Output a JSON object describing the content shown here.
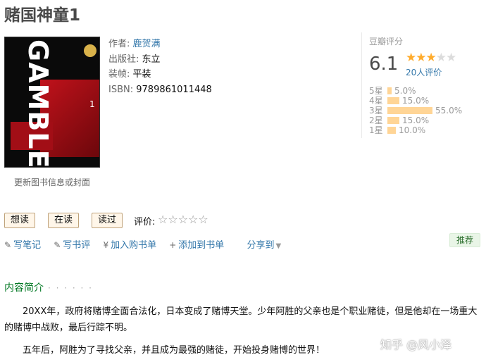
{
  "title": "赌国神童1",
  "cover": {
    "art_text": "GAMBLE!",
    "volume": "1",
    "update_link": "更新图书信息或封面"
  },
  "info": {
    "author_label": "作者:",
    "author": "鹿贺满",
    "publisher_label": "出版社:",
    "publisher": "东立",
    "binding_label": "装帧:",
    "binding": "平装",
    "isbn_label": "ISBN:",
    "isbn": "9789861011448"
  },
  "rating": {
    "label": "豆瓣评分",
    "score": "6.1",
    "stars_filled": 3,
    "stars_total": 5,
    "count": "20人评价",
    "distribution": [
      {
        "label": "5星",
        "pct": "5.0%",
        "value": 5.0
      },
      {
        "label": "4星",
        "pct": "15.0%",
        "value": 15.0
      },
      {
        "label": "3星",
        "pct": "55.0%",
        "value": 55.0
      },
      {
        "label": "2星",
        "pct": "15.0%",
        "value": 15.0
      },
      {
        "label": "1星",
        "pct": "10.0%",
        "value": 10.0
      }
    ]
  },
  "buttons": {
    "want": "想读",
    "reading": "在读",
    "read": "读过",
    "rate_label": "评价:",
    "rate_stars": "☆☆☆☆☆"
  },
  "actions": {
    "note": "写笔记",
    "review": "写书评",
    "cart": "加入购书单",
    "add_list": "添加到书单",
    "share": "分享到",
    "recommend": "推荐"
  },
  "summary": {
    "title": "内容简介",
    "dots": "· · · · · ·",
    "p1": "20XX年，政府将赌博全面合法化，日本变成了赌博天堂。少年阿胜的父亲也是个职业赌徒，但是他却在一场重大的赌博中战败，最后行踪不明。",
    "p2": "五年后，阿胜为了寻找父亲，并且成为最强的赌徒，开始投身赌博的世界！"
  },
  "watermark": "知乎 @风小泽",
  "colors": {
    "link": "#3377aa",
    "star": "#ffac2d",
    "bar": "#ffd596",
    "section": "#007722"
  }
}
